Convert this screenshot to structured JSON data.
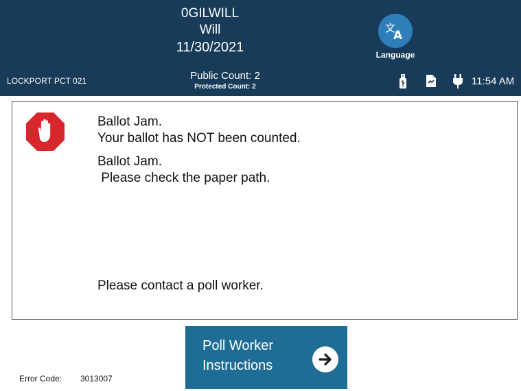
{
  "header": {
    "line1": "0GILWILL",
    "line2": "Will",
    "date": "11/30/2021",
    "language_label": "Language",
    "precinct": "LOCKPORT PCT 021",
    "public_count": "Public Count: 2",
    "protected_count": "Protected Count: 2",
    "time": "11:54 AM",
    "status_icons": [
      "usb-icon",
      "document-icon",
      "power-plug-icon"
    ]
  },
  "message": {
    "icon": "stop-hand-icon",
    "lines": [
      "Ballot Jam.",
      "Your ballot has NOT been counted.",
      "Ballot Jam.",
      " Please check the paper path.",
      "Please contact a poll worker."
    ]
  },
  "button": {
    "line1": "Poll Worker",
    "line2": "Instructions",
    "icon": "arrow-right-icon"
  },
  "footer": {
    "error_label": "Error Code:",
    "error_code": "3013007"
  },
  "colors": {
    "header_bg": "#173b58",
    "language_button": "#2e7fb9",
    "primary_button": "#1f6d95",
    "stop_red": "#d7262c"
  }
}
